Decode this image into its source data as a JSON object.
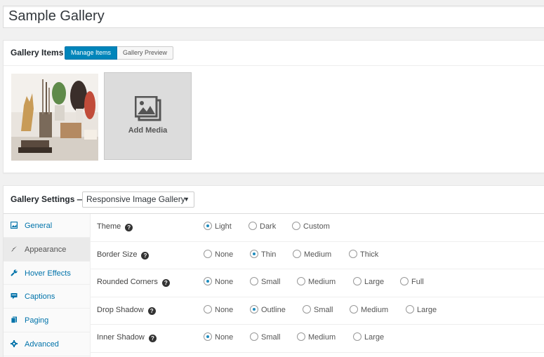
{
  "gallery_title": "Sample Gallery",
  "items_panel": {
    "heading": "Gallery Items",
    "tabs": [
      {
        "label": "Manage Items",
        "active": true
      },
      {
        "label": "Gallery Preview",
        "active": false
      }
    ],
    "add_media_label": "Add Media"
  },
  "settings_panel": {
    "heading": "Gallery Settings —",
    "template_select": "Responsive Image Gallery",
    "nav": [
      {
        "label": "General",
        "icon": "image-icon",
        "active": false
      },
      {
        "label": "Appearance",
        "icon": "brush-icon",
        "active": true
      },
      {
        "label": "Hover Effects",
        "icon": "wrench-icon",
        "active": false
      },
      {
        "label": "Captions",
        "icon": "comment-icon",
        "active": false
      },
      {
        "label": "Paging",
        "icon": "pages-icon",
        "active": false
      },
      {
        "label": "Advanced",
        "icon": "gear-icon",
        "active": false
      }
    ],
    "rows": [
      {
        "label": "Theme",
        "options": [
          "Light",
          "Dark",
          "Custom"
        ],
        "selected": 0
      },
      {
        "label": "Border Size",
        "options": [
          "None",
          "Thin",
          "Medium",
          "Thick"
        ],
        "selected": 1
      },
      {
        "label": "Rounded Corners",
        "options": [
          "None",
          "Small",
          "Medium",
          "Large",
          "Full"
        ],
        "selected": 0
      },
      {
        "label": "Drop Shadow",
        "options": [
          "None",
          "Outline",
          "Small",
          "Medium",
          "Large"
        ],
        "selected": 1
      },
      {
        "label": "Inner Shadow",
        "options": [
          "None",
          "Small",
          "Medium",
          "Large"
        ],
        "selected": 0
      }
    ]
  },
  "colors": {
    "accent": "#0085ba",
    "link": "#0073aa"
  }
}
